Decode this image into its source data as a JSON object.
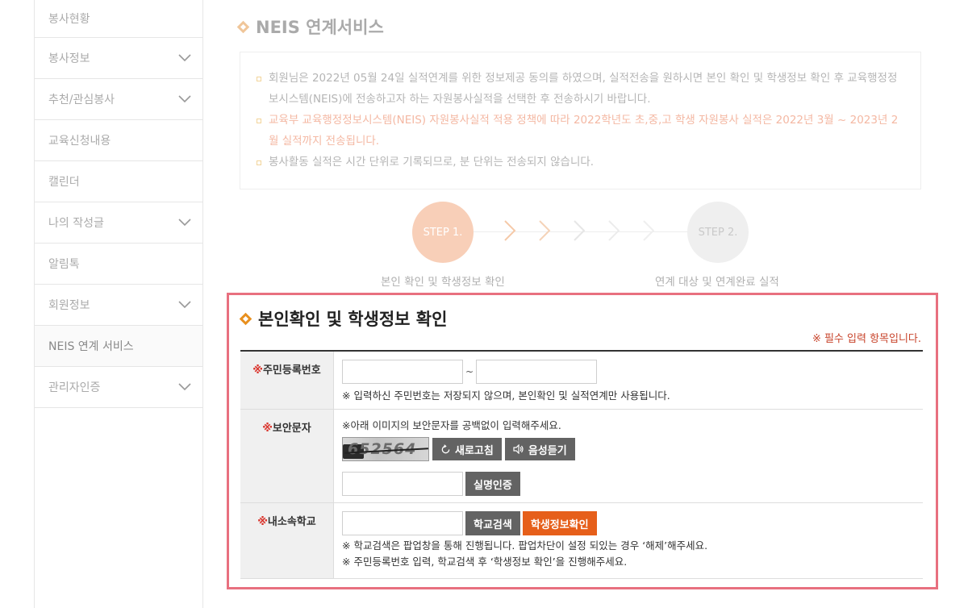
{
  "sidebar": {
    "items": [
      {
        "label": "봉사현황",
        "has_sub": false
      },
      {
        "label": "봉사정보",
        "has_sub": true
      },
      {
        "label": "추천/관심봉사",
        "has_sub": true
      },
      {
        "label": "교육신청내용",
        "has_sub": false
      },
      {
        "label": "캘린더",
        "has_sub": false
      },
      {
        "label": "나의 작성글",
        "has_sub": true
      },
      {
        "label": "알림톡",
        "has_sub": false
      },
      {
        "label": "회원정보",
        "has_sub": true
      },
      {
        "label": "NEIS 연계 서비스",
        "has_sub": false,
        "active": true
      },
      {
        "label": "관리자인증",
        "has_sub": true
      }
    ]
  },
  "page": {
    "title": "NEIS 연계서비스"
  },
  "notice": {
    "line1": "회원님은 2022년 05월 24일 실적연계를 위한 정보제공 동의를 하였으며, 실적전송을 원하시면 본인 확인 및 학생정보 확인 후 교육행정정보시스템(NEIS)에 전송하고자 하는 자원봉사실적을 선택한 후 전송하시기 바랍니다.",
    "line2": "교육부 교육행정정보시스템(NEIS) 자원봉사실적 적용 정책에 따라 2022학년도 초,중,고 학생 자원봉사 실적은 2022년 3월 ~ 2023년 2월 실적까지 전송됩니다.",
    "line3": "봉사활동 실적은 시간 단위로 기록되므로, 분 단위는 전송되지 않습니다."
  },
  "steps": {
    "step1": "STEP 1.",
    "step1_label": "본인 확인 및 학생정보 확인",
    "step2": "STEP 2.",
    "step2_label": "연계 대상 및 연계완료 실적"
  },
  "form": {
    "title": "본인확인 및 학생정보 확인",
    "required_note": "※ 필수 입력 항목입니다.",
    "rrn": {
      "mark": "※",
      "label": "주민등록번호",
      "separator": "~",
      "help": "※ 입력하신 주민번호는 저장되지 않으며, 본인확인 및 실적연계만 사용됩니다."
    },
    "captcha": {
      "mark": "※",
      "label": "보안문자",
      "help": "※아래 이미지의 보안문자를 공백없이 입력해주세요.",
      "image_text": "652564",
      "refresh_label": "새로고침",
      "audio_label": "음성듣기",
      "verify_label": "실명인증"
    },
    "school": {
      "mark": "※",
      "label": "내소속학교",
      "search_label": "학교검색",
      "confirm_label": "학생정보확인",
      "help1": "※ 학교검색은 팝업창을 통해 진행됩니다. 팝업차단이 설정 되있는 경우 ‘해제’해주세요.",
      "help2": "※ 주민등록번호 입력, 학교검색 후 ‘학생정보 확인’을 진행해주세요."
    }
  }
}
